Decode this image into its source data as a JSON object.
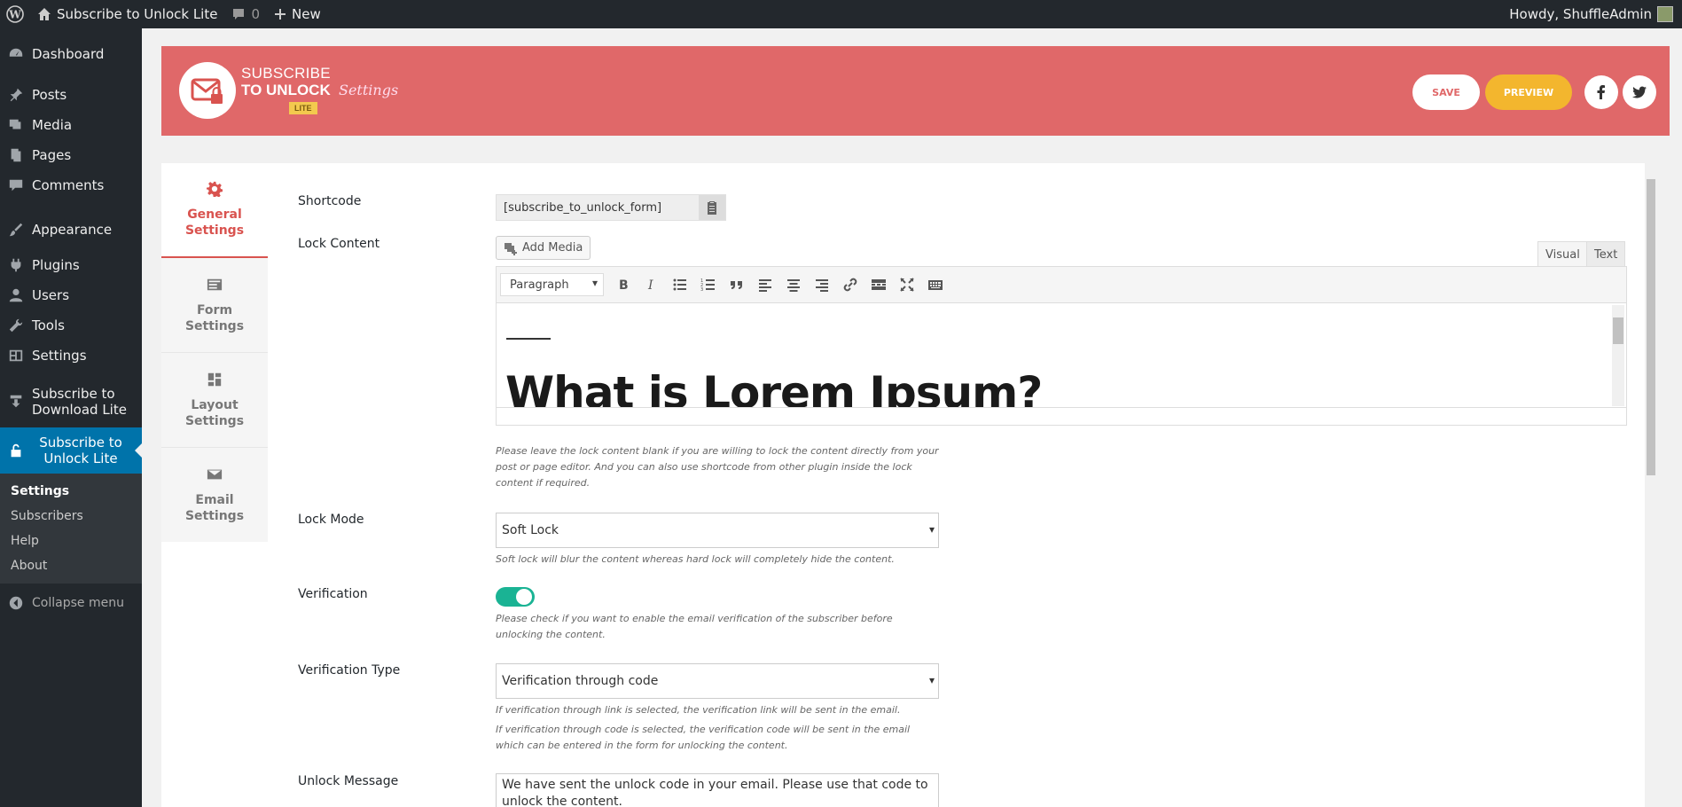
{
  "adminbar": {
    "site_name": "Subscribe to Unlock Lite",
    "comments_count": "0",
    "new_label": "New",
    "greeting": "Howdy, ShuffleAdmin"
  },
  "sidebar": {
    "items": [
      {
        "label": "Dashboard"
      },
      {
        "label": "Posts"
      },
      {
        "label": "Media"
      },
      {
        "label": "Pages"
      },
      {
        "label": "Comments"
      },
      {
        "label": "Appearance"
      },
      {
        "label": "Plugins"
      },
      {
        "label": "Users"
      },
      {
        "label": "Tools"
      },
      {
        "label": "Settings"
      },
      {
        "label": "Subscribe to Download Lite"
      },
      {
        "label": "Subscribe to Unlock Lite"
      }
    ],
    "submenu": [
      "Settings",
      "Subscribers",
      "Help",
      "About"
    ],
    "collapse_label": "Collapse menu"
  },
  "banner": {
    "logo_line1": "SUBSCRIBE",
    "logo_line2": "TO UNLOCK",
    "logo_badge": "LITE",
    "page_label": "Settings",
    "save_label": "SAVE",
    "preview_label": "PREVIEW"
  },
  "tabs": [
    {
      "line1": "General",
      "line2": "Settings"
    },
    {
      "line1": "Form",
      "line2": "Settings"
    },
    {
      "line1": "Layout",
      "line2": "Settings"
    },
    {
      "line1": "Email",
      "line2": "Settings"
    }
  ],
  "form": {
    "shortcode_label": "Shortcode",
    "shortcode_value": "[subscribe_to_unlock_form]",
    "lock_content_label": "Lock Content",
    "add_media_label": "Add Media",
    "visual_tab": "Visual",
    "text_tab": "Text",
    "format_select": "Paragraph",
    "editor_heading": "What is Lorem Ipsum?",
    "lock_content_help": "Please leave the lock content blank if you are willing to lock the content directly from your post or page editor. And you can also use shortcode from other plugin inside the lock content if required.",
    "lock_mode_label": "Lock Mode",
    "lock_mode_value": "Soft Lock",
    "lock_mode_help": "Soft lock will blur the content whereas hard lock will completely hide the content.",
    "verification_label": "Verification",
    "verification_enabled": true,
    "verification_help": "Please check if you want to enable the email verification of the subscriber before unlocking the content.",
    "verification_type_label": "Verification Type",
    "verification_type_value": "Verification through code",
    "verification_type_help1": "If verification through link is selected, the verification link will be sent in the email.",
    "verification_type_help2": "If verification through code is selected, the verification code will be sent in the email which can be entered in the form for unlocking the content.",
    "unlock_message_label": "Unlock Message",
    "unlock_message_value": "We have sent the unlock code in your email. Please use that code to unlock the content."
  },
  "colors": {
    "banner": "#e06869",
    "accent": "#d9534f",
    "preview": "#f3b62e",
    "toggle": "#1ab394",
    "wp_blue": "#0073aa"
  }
}
